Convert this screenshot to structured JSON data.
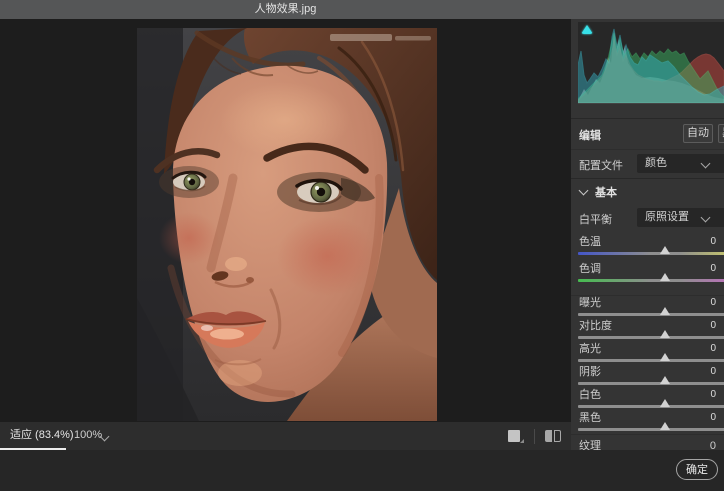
{
  "window": {
    "title": "人物效果.jpg"
  },
  "statusbar": {
    "fit_label": "适应 (83.4%)",
    "zoom_value": "100%"
  },
  "footer": {
    "ok_label": "确定"
  },
  "panel": {
    "edit_label": "编辑",
    "auto_label": "自动",
    "more_label": "黑白",
    "profile_label": "配置文件",
    "profile_value": "颜色",
    "basic_label": "基本",
    "wb_label": "白平衡",
    "wb_value": "原照设置",
    "sliders": [
      {
        "label": "色温",
        "value": "0"
      },
      {
        "label": "色调",
        "value": "0"
      },
      {
        "label": "曝光",
        "value": "0"
      },
      {
        "label": "对比度",
        "value": "0"
      },
      {
        "label": "高光",
        "value": "0"
      },
      {
        "label": "阴影",
        "value": "0"
      },
      {
        "label": "白色",
        "value": "0"
      },
      {
        "label": "黑色",
        "value": "0"
      }
    ],
    "texture": {
      "label": "纹理",
      "value": "0"
    }
  },
  "histogram": {
    "channels": [
      "red",
      "green",
      "blue"
    ],
    "colors": {
      "red": "#c84840",
      "green": "#3cbe66",
      "blue": "#35b4c8",
      "overlap": "#807a76",
      "shadow_clipping_indicator": "#38e0e8"
    }
  },
  "colors": {
    "titlebar": "#555657",
    "canvas": "#1d1d1d",
    "panel": "#343434",
    "statusbar": "#2d2d2d",
    "footer": "#262626"
  }
}
